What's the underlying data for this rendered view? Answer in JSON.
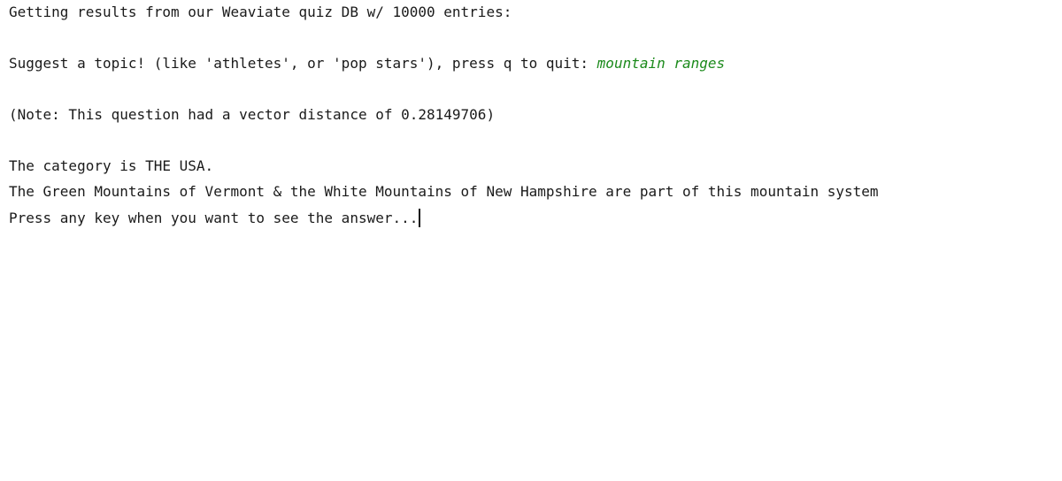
{
  "terminal": {
    "line_intro": "Getting results from our Weaviate quiz DB w/ 10000 entries:",
    "prompt_text": "Suggest a topic! (like 'athletes', or 'pop stars'), press q to quit: ",
    "prompt_input": "mountain ranges",
    "note": "(Note: This question had a vector distance of 0.28149706)",
    "category": "The category is THE USA.",
    "question": "The Green Mountains of Vermont & the White Mountains of New Hampshire are part of this mountain system",
    "press_key": "Press any key when you want to see the answer..."
  },
  "colors": {
    "text": "#1a1a1a",
    "input": "#1b8a1b",
    "background": "#ffffff"
  }
}
